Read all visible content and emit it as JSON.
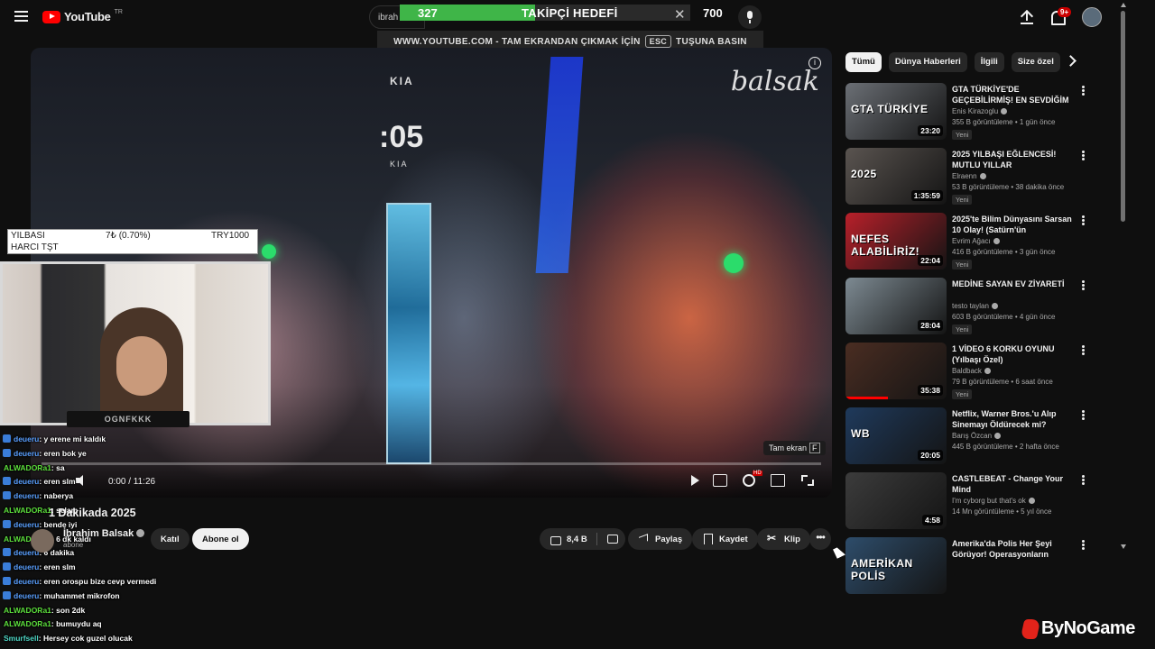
{
  "header": {
    "logo_text": "YouTube",
    "country": "TR",
    "search_text": "ibrah",
    "notifications_badge": "9+"
  },
  "goal_overlay": {
    "current": "327",
    "label": "TAKİPÇİ HEDEFİ",
    "target": "700",
    "progress": 0.467,
    "fill_color": "#3fb548"
  },
  "fullscreen_hint": {
    "before": "WWW.YOUTUBE.COM - TAM EKRANDAN ÇIKMAK İÇİN",
    "key": "ESC",
    "after": "TUŞUNA BASIN"
  },
  "video": {
    "watermark": "balsak",
    "countdown": ":05",
    "brand": "KIA",
    "brand2": "KIA",
    "tooltip": "Tam ekran",
    "tooltip_key": "F",
    "time": "0:00 / 11:26"
  },
  "donation": {
    "line1": "YILBASI",
    "line2": "HARCI TŞT",
    "amount": "7₺ (0.70%)",
    "currency_amount": "TRY1000"
  },
  "webcam": {
    "banner": "OGNFKKK"
  },
  "chat": [
    {
      "user": "deueru",
      "msg": ": y erene mi kaldık",
      "color": "blue",
      "badge": true
    },
    {
      "user": "deueru",
      "msg": ": eren bok ye",
      "color": "blue",
      "badge": true
    },
    {
      "user": "ALWADORa1",
      "msg": ": sa",
      "color": "green",
      "badge": false
    },
    {
      "user": "deueru",
      "msg": ": eren slm",
      "color": "blue",
      "badge": true
    },
    {
      "user": "deueru",
      "msg": ": naberya",
      "color": "blue",
      "badge": true
    },
    {
      "user": "ALWADORa1",
      "msg": ": selam",
      "color": "green",
      "badge": false
    },
    {
      "user": "deueru",
      "msg": ": bende iyi",
      "color": "blue",
      "badge": true
    },
    {
      "user": "ALWADORa1",
      "msg": ": 6 dk kaldı",
      "color": "green",
      "badge": false
    },
    {
      "user": "deueru",
      "msg": ": 6 dakika",
      "color": "blue",
      "badge": true
    },
    {
      "user": "deueru",
      "msg": ": eren slm",
      "color": "blue",
      "badge": true
    },
    {
      "user": "deueru",
      "msg": ": eren orospu bize cevp vermedi",
      "color": "blue",
      "badge": true
    },
    {
      "user": "deueru",
      "msg": ": muhammet mikrofon",
      "color": "blue",
      "badge": true
    },
    {
      "user": "ALWADORa1",
      "msg": ": son 2dk",
      "color": "green",
      "badge": false
    },
    {
      "user": "ALWADORa1",
      "msg": ": bumuydu aq",
      "color": "green",
      "badge": false
    },
    {
      "user": "Smurfsell",
      "msg": ": Hersey cok guzel olucak",
      "color": "teal",
      "badge": false
    }
  ],
  "below_video": {
    "title": "1 Dakikada 2025",
    "channel": "İbrahim Balsak",
    "subscribers": "abone",
    "join_label": "Katıl",
    "subscribe_label": "Abone ol",
    "likes": "8,4 B",
    "share_label": "Paylaş",
    "save_label": "Kaydet",
    "clip_label": "Klip"
  },
  "chips": [
    "Tümü",
    "Dünya Haberleri",
    "İlgili",
    "Size özel"
  ],
  "recommendations": [
    {
      "title": "GTA TÜRKİYE'DE GEÇEBİLİRMİŞ! EN SEVDİĞİM ...",
      "channel": "Enis Kirazoglu",
      "stats": "355 B görüntüleme • 1 gün önce",
      "duration": "23:20",
      "badge": "Yeni",
      "caption": "GTA TÜRKİYE",
      "bg": "#6b6f75",
      "watched": 0
    },
    {
      "title": "2025 YILBAŞI EĞLENCESİ! MUTLU YILLAR",
      "channel": "Elraenn",
      "stats": "53 B görüntüleme • 38 dakika önce",
      "duration": "1:35:59",
      "badge": "Yeni",
      "caption": "2025",
      "bg": "#5a5450",
      "watched": 0
    },
    {
      "title": "2025'te Bilim Dünyasını Sarsan 10 Olay! (Satürn'ün Halkalarına...",
      "channel": "Evrim Ağacı",
      "stats": "416 B görüntüleme • 3 gün önce",
      "duration": "22:04",
      "badge": "Yeni",
      "caption": "NEFES ALABİLİRİZ!",
      "bg": "#b8202a",
      "watched": 0
    },
    {
      "title": "MEDİNE SAYAN EV ZİYARETİ",
      "channel": "testo taylan",
      "stats": "603 B görüntüleme • 4 gün önce",
      "duration": "28:04",
      "badge": "Yeni",
      "caption": "",
      "bg": "#7d8a92",
      "watched": 0
    },
    {
      "title": "1 VİDEO 6 KORKU OYUNU (Yılbaşı Özel)",
      "channel": "Baldback",
      "stats": "79 B görüntüleme • 6 saat önce",
      "duration": "35:38",
      "badge": "Yeni",
      "caption": "",
      "bg": "#4a2d22",
      "watched": 0.42
    },
    {
      "title": "Netflix, Warner Bros.'u Alıp Sinemayı Öldürecek mi?",
      "channel": "Barış Özcan",
      "stats": "445 B görüntüleme • 2 hafta önce",
      "duration": "20:05",
      "badge": "",
      "caption": "WB",
      "bg": "#1f3a5c",
      "watched": 0
    },
    {
      "title": "CASTLEBEAT - Change Your Mind",
      "channel": "I'm cyborg but that's ok",
      "stats": "14 Mn görüntüleme • 5 yıl önce",
      "duration": "4:58",
      "badge": "",
      "caption": "",
      "bg": "#3c3c3c",
      "watched": 0
    },
    {
      "title": "Amerika'da Polis Her Şeyi Görüyor! Operasyonların Perde...",
      "channel": "",
      "stats": "",
      "duration": "",
      "badge": "",
      "caption": "AMERİKAN POLİS",
      "bg": "#2e4d6b",
      "watched": 0
    }
  ],
  "branding": {
    "overlay_logo": "ByNoGame"
  }
}
